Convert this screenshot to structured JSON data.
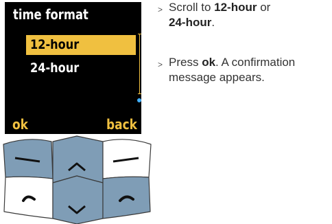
{
  "screen": {
    "title": "time format",
    "options": [
      "12-hour",
      "24-hour"
    ],
    "selected_index": 0,
    "softkey_left": "ok",
    "softkey_right": "back"
  },
  "keypad": {
    "keys": [
      "left-softkey-icon",
      "nav-up-icon",
      "right-softkey-icon",
      "call-icon",
      "nav-down-icon",
      "end-call-icon"
    ]
  },
  "instructions": [
    {
      "bullet": ">",
      "pre": "Scroll to ",
      "b1": "12-hour",
      "mid": " or ",
      "b2": "24-hour",
      "post": "."
    },
    {
      "bullet": ">",
      "pre": "Press ",
      "b1": "ok",
      "post": ". A confirmation message appears."
    }
  ],
  "colors": {
    "highlight": "#f0c040",
    "scroll_thumb": "#41b0ff",
    "key_blue": "#7f9db6",
    "key_white": "#ffffff"
  }
}
